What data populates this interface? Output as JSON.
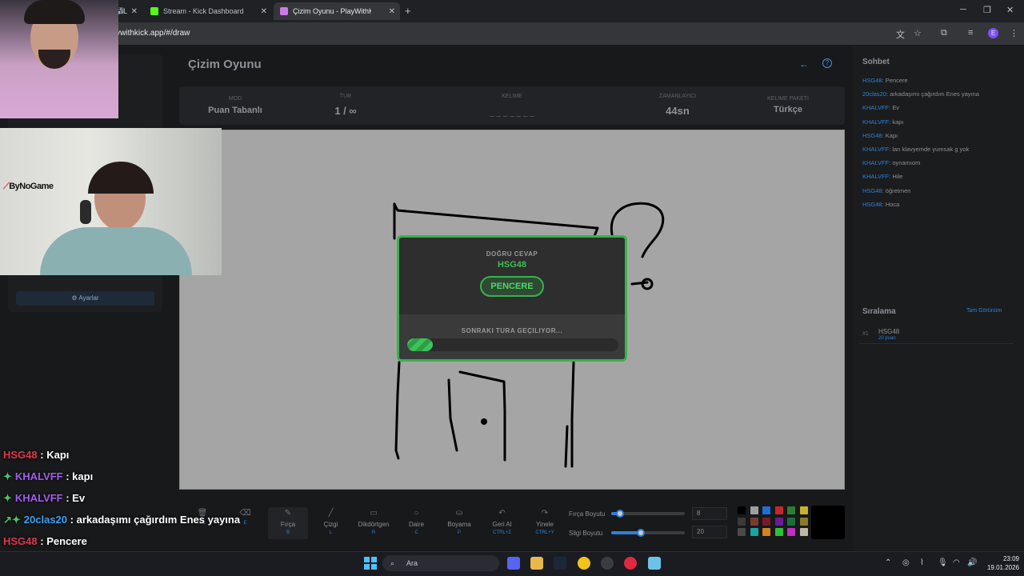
{
  "browser": {
    "tabs": [
      {
        "label": "BAY (OFFICIAL",
        "active": false
      },
      {
        "label": "Stream - Kick Dashboard",
        "active": false
      },
      {
        "label": "Çizim Oyunu - PlayWithKick",
        "active": true
      }
    ],
    "new_tab_glyph": "+",
    "url": "demo.playwithkick.app/#/draw"
  },
  "game": {
    "title": "Çizim Oyunu",
    "info": {
      "mode_label": "MOD",
      "mode_value": "Puan Tabanlı",
      "round_label": "TUR",
      "round_value": "1 / ∞",
      "word_label": "KELIME",
      "word_value": "_ _ _ _ _ _ _",
      "timer_label": "ZAMANLAYICI",
      "timer_value": "44sn",
      "pack_label": "KELIME PAKETI",
      "pack_value": "Türkçe"
    },
    "modal": {
      "label": "DOĞRU CEVAP",
      "winner": "HSG48",
      "answer": "PENCERE",
      "next_label": "SONRAKI TURA GEÇILIYOR...",
      "progress": 0.12
    },
    "tools": [
      {
        "name": "tool-clear",
        "icon": "trash-icon",
        "glyph": "🗑",
        "label": "",
        "key": "SIL"
      },
      {
        "name": "tool-eraser",
        "icon": "eraser-icon",
        "glyph": "⌫",
        "label": "",
        "key": "E"
      },
      {
        "name": "tool-brush",
        "icon": "brush-icon",
        "glyph": "✎",
        "label": "Fırça",
        "key": "B"
      },
      {
        "name": "tool-line",
        "icon": "line-icon",
        "glyph": "╱",
        "label": "Çizgi",
        "key": "L"
      },
      {
        "name": "tool-rectangle",
        "icon": "rectangle-icon",
        "glyph": "▭",
        "label": "Dikdörtgen",
        "key": "R"
      },
      {
        "name": "tool-circle",
        "icon": "circle-icon",
        "glyph": "○",
        "label": "Daire",
        "key": "C"
      },
      {
        "name": "tool-fill",
        "icon": "bucket-icon",
        "glyph": "⛀",
        "label": "Boyama",
        "key": "P"
      },
      {
        "name": "tool-undo",
        "icon": "undo-icon",
        "glyph": "↶",
        "label": "Geri Al",
        "key": "CTRL+Z"
      },
      {
        "name": "tool-redo",
        "icon": "redo-icon",
        "glyph": "↷",
        "label": "Yinele",
        "key": "CTRL+Y"
      }
    ],
    "brush_size_label": "Fırça Boyutu",
    "brush_size": "8",
    "brush_size_level": 0.12,
    "eraser_size_label": "Silgi Boyutu",
    "eraser_size": "20",
    "eraser_size_level": 0.4,
    "palette": [
      "#000000",
      "#9e9e9e",
      "#1e6fd9",
      "#c62828",
      "#2e7d32",
      "#c9b22a",
      "#3a3a3a",
      "#7a3b2e",
      "#7a1a2a",
      "#6a1b9a",
      "#1b6e3a",
      "#8a7a2a",
      "#4a4a4a",
      "#19a3a3",
      "#d4831f",
      "#2fbf3a",
      "#c02fc0",
      "#bdb8a8"
    ],
    "settings_label": "Ayarlar"
  },
  "chat": {
    "title": "Sohbet",
    "messages": [
      {
        "user": "HSG48",
        "text": "Pencere"
      },
      {
        "user": "20clas20",
        "text": "arkadaşımı çağırdım Enes yayına"
      },
      {
        "user": "KHALVFF",
        "text": "Ev"
      },
      {
        "user": "KHALVFF",
        "text": "kapı"
      },
      {
        "user": "HSG48",
        "text": "Kapı"
      },
      {
        "user": "KHALVFF",
        "text": "lan klavyemde yumsak g yok"
      },
      {
        "user": "KHALVFF",
        "text": "oynamıom"
      },
      {
        "user": "KHALVFF",
        "text": "Hile"
      },
      {
        "user": "HSG48",
        "text": "öğretmen"
      },
      {
        "user": "HSG48",
        "text": "Hoca"
      }
    ],
    "ranking_title": "Sıralama",
    "ranking_link": "Tam Görünüm",
    "ranking": [
      {
        "rank": "#1",
        "user": "HSG48",
        "points": "20 puan"
      }
    ]
  },
  "overlay": {
    "logo": "ByNoGame",
    "chat": [
      {
        "user": "HSG48",
        "text": ": Kapı",
        "style": "u1",
        "badge": ""
      },
      {
        "user": "KHALVFF",
        "text": ": kapı",
        "style": "u2",
        "badge": "✦"
      },
      {
        "user": "KHALVFF",
        "text": ": Ev",
        "style": "u2",
        "badge": "✦"
      },
      {
        "user": "20clas20",
        "text": ": arkadaşımı çağırdım Enes yayına",
        "style": "u3",
        "badge": "↗✦"
      },
      {
        "user": "HSG48",
        "text": ": Pencere",
        "style": "u1",
        "badge": ""
      }
    ]
  },
  "taskbar": {
    "search_placeholder": "Ara",
    "time": "23:09",
    "date": "19.01.2026"
  }
}
